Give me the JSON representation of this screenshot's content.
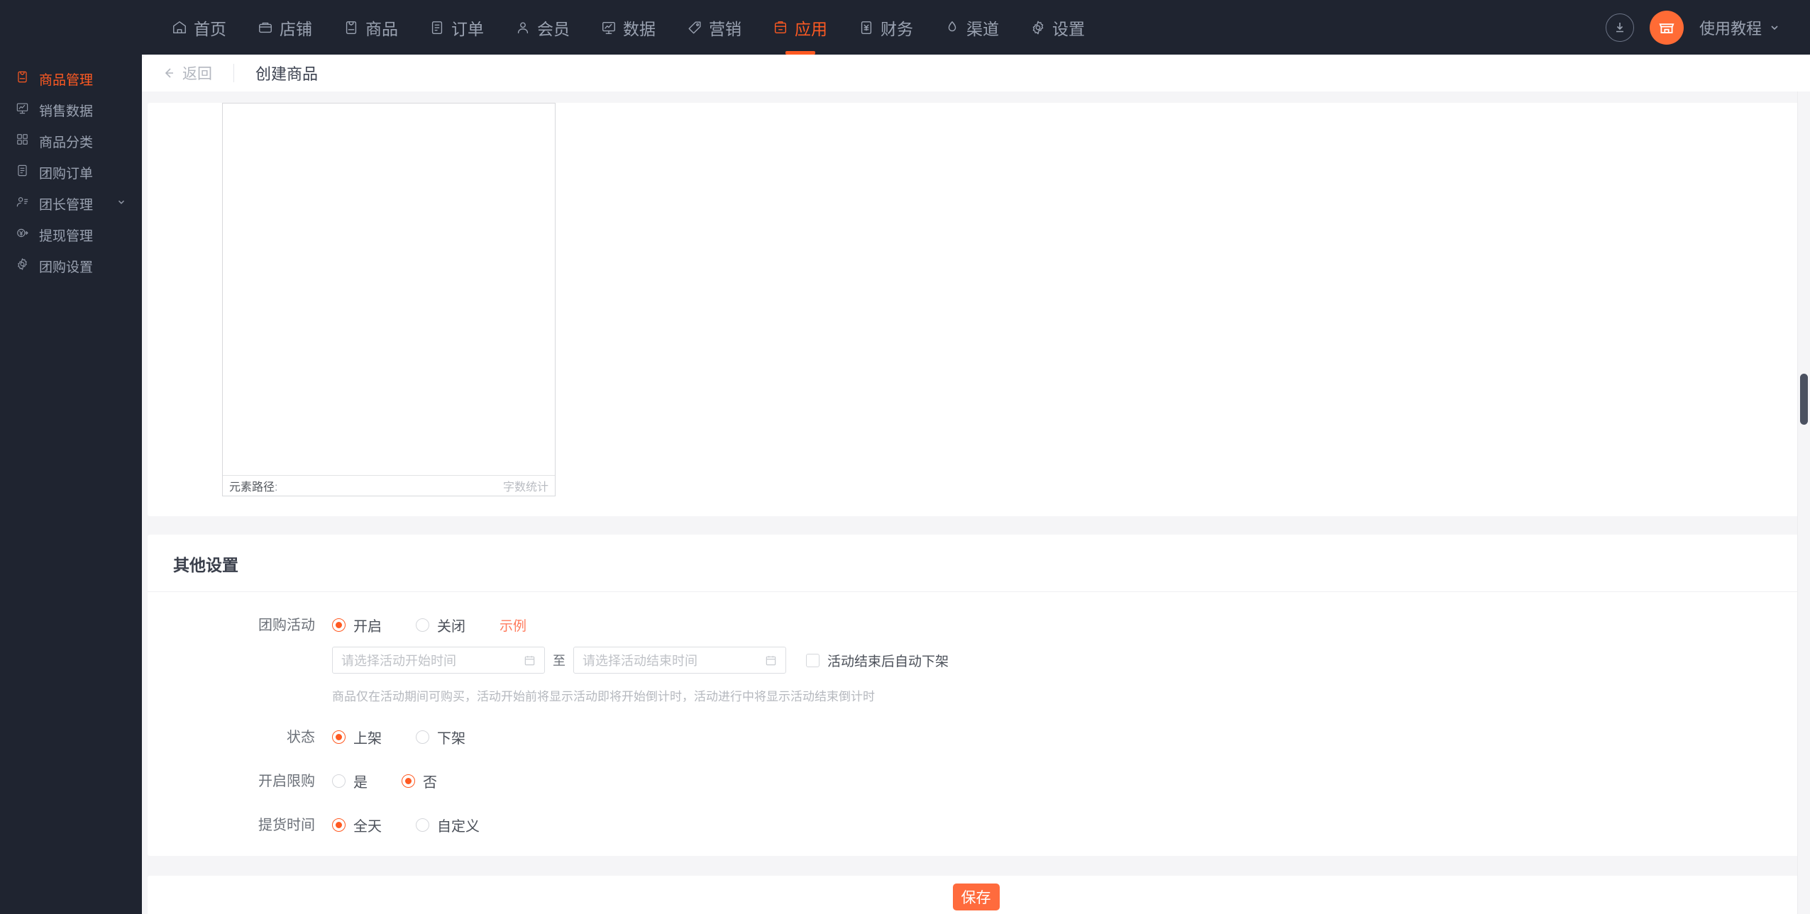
{
  "topnav": {
    "items": [
      {
        "label": "首页",
        "icon": "home-icon",
        "active": false
      },
      {
        "label": "店铺",
        "icon": "shop-icon",
        "active": false
      },
      {
        "label": "商品",
        "icon": "goods-icon",
        "active": false
      },
      {
        "label": "订单",
        "icon": "order-icon",
        "active": false
      },
      {
        "label": "会员",
        "icon": "member-icon",
        "active": false
      },
      {
        "label": "数据",
        "icon": "data-icon",
        "active": false
      },
      {
        "label": "营销",
        "icon": "marketing-icon",
        "active": false
      },
      {
        "label": "应用",
        "icon": "app-icon",
        "active": true
      },
      {
        "label": "财务",
        "icon": "finance-icon",
        "active": false
      },
      {
        "label": "渠道",
        "icon": "channel-icon",
        "active": false
      },
      {
        "label": "设置",
        "icon": "settings-icon",
        "active": false
      }
    ],
    "download_icon": "download-icon",
    "avatar_icon": "shop-avatar-icon",
    "tutorial_label": "使用教程",
    "tutorial_caret": "chevron-down-icon"
  },
  "sidebar": {
    "items": [
      {
        "label": "商品管理",
        "icon": "goods-manage-icon",
        "active": true,
        "caret": false
      },
      {
        "label": "销售数据",
        "icon": "sales-data-icon",
        "active": false,
        "caret": false
      },
      {
        "label": "商品分类",
        "icon": "goods-category-icon",
        "active": false,
        "caret": false
      },
      {
        "label": "团购订单",
        "icon": "group-order-icon",
        "active": false,
        "caret": false
      },
      {
        "label": "团长管理",
        "icon": "leader-manage-icon",
        "active": false,
        "caret": true
      },
      {
        "label": "提现管理",
        "icon": "withdraw-icon",
        "active": false,
        "caret": false
      },
      {
        "label": "团购设置",
        "icon": "group-settings-icon",
        "active": false,
        "caret": false
      }
    ]
  },
  "page_head": {
    "back_label": "返回",
    "back_icon": "arrow-left-icon",
    "title": "创建商品"
  },
  "editor": {
    "element_path_label": "元素路径",
    "element_path_value": ":",
    "word_count_label": "字数统计"
  },
  "settings": {
    "title": "其他设置",
    "group_activity": {
      "label": "团购活动",
      "options": [
        {
          "label": "开启",
          "checked": true
        },
        {
          "label": "关闭",
          "checked": false
        }
      ],
      "example_label": "示例",
      "start_placeholder": "请选择活动开始时间",
      "start_value": "",
      "end_placeholder": "请选择活动结束时间",
      "end_value": "",
      "separator": "至",
      "calendar_icon": "calendar-icon",
      "auto_offshelf_label": "活动结束后自动下架",
      "auto_offshelf_checked": false,
      "hint": "商品仅在活动期间可购买，活动开始前将显示活动即将开始倒计时，活动进行中将显示活动结束倒计时"
    },
    "status": {
      "label": "状态",
      "options": [
        {
          "label": "上架",
          "checked": true
        },
        {
          "label": "下架",
          "checked": false
        }
      ]
    },
    "purchase_limit": {
      "label": "开启限购",
      "options": [
        {
          "label": "是",
          "checked": false
        },
        {
          "label": "否",
          "checked": true
        }
      ]
    },
    "pickup_time": {
      "label": "提货时间",
      "options": [
        {
          "label": "全天",
          "checked": true
        },
        {
          "label": "自定义",
          "checked": false
        }
      ]
    }
  },
  "footer": {
    "save_label": "保存"
  },
  "colors": {
    "accent": "#ff5a22",
    "save_button": "#ff6b3d",
    "nav_bg": "#1f2430",
    "page_bg": "#f5f5f7"
  }
}
